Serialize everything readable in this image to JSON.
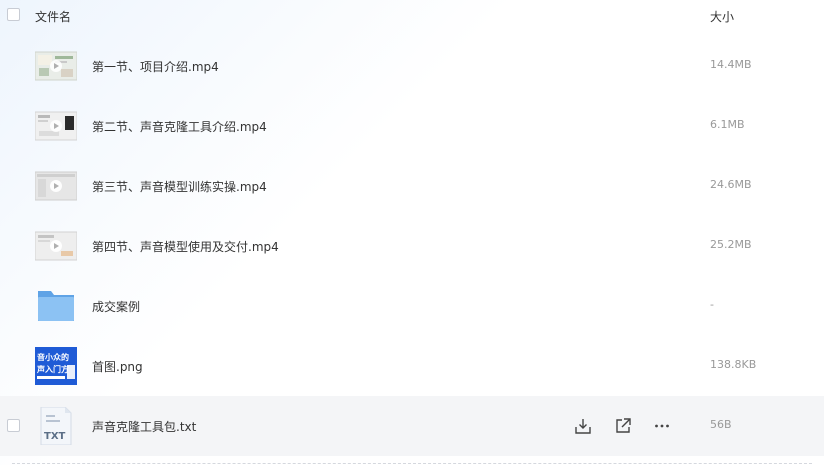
{
  "header": {
    "name_label": "文件名",
    "size_label": "大小"
  },
  "files": [
    {
      "name": "第一节、项目介绍.mp4",
      "size": "14.4MB",
      "type": "video"
    },
    {
      "name": "第二节、声音克隆工具介绍.mp4",
      "size": "6.1MB",
      "type": "video"
    },
    {
      "name": "第三节、声音模型训练实操.mp4",
      "size": "24.6MB",
      "type": "video"
    },
    {
      "name": "第四节、声音模型使用及交付.mp4",
      "size": "25.2MB",
      "type": "video"
    },
    {
      "name": "成交案例",
      "size": "-",
      "type": "folder"
    },
    {
      "name": "首图.png",
      "size": "138.8KB",
      "type": "image",
      "thumb_text": [
        "音小众的",
        "声入门方"
      ]
    },
    {
      "name": "声音克隆工具包.txt",
      "size": "56B",
      "type": "txt",
      "icon_text": "TXT"
    }
  ],
  "row_actions": {
    "download_icon": "download-icon",
    "share_icon": "share-icon",
    "more_icon": "more-icon"
  },
  "colors": {
    "folder": "#7fb9f0",
    "image_bg": "#1f5bd6",
    "hover_row": "#f4f5f7"
  }
}
